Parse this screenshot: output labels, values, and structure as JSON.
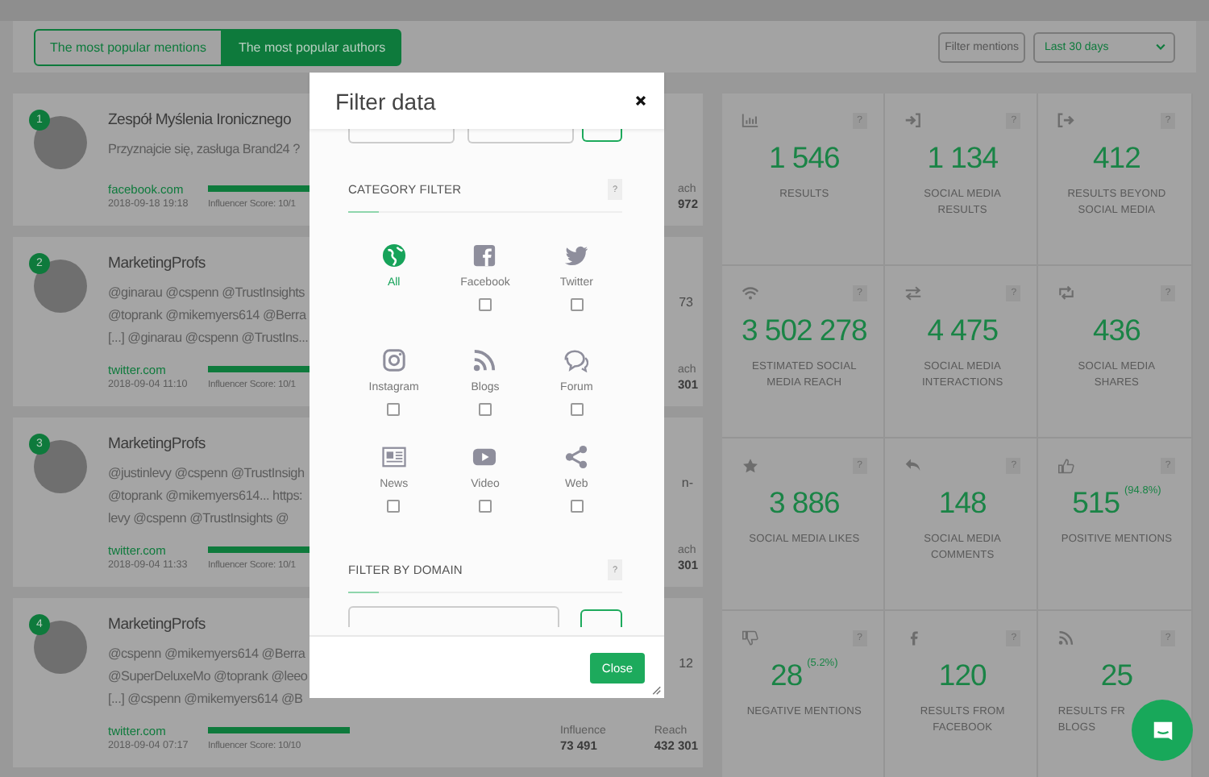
{
  "header": {
    "tabs": [
      {
        "label": "The most popular mentions",
        "selected": false
      },
      {
        "label": "The most popular authors",
        "selected": true
      }
    ],
    "filter_button": "Filter mentions",
    "period": "Last 30 days"
  },
  "authors": [
    {
      "rank": "1",
      "name": "Zespół Myślenia Ironicznego",
      "lines": [
        "Przyznajcie się, zasługa Brand24 ?"
      ],
      "source": "facebook.com",
      "date": "2018-09-18 19:18",
      "score": {
        "level": 1,
        "label": "Influencer Score: 10/1"
      },
      "metrics": [
        {
          "label": "ach",
          "value": "972"
        }
      ]
    },
    {
      "rank": "2",
      "name": "MarketingProfs",
      "lines": [
        "@ginarau @cspenn @TrustInsights",
        "@toprank @mikemyers614 @Berra",
        "[...] @ginarau @cspenn @TrustIns..."
      ],
      "source": "twitter.com",
      "date": "2018-09-04 11:10",
      "score": {
        "level": 1,
        "label": "Influencer Score: 10/1"
      },
      "edge_text": "73",
      "metrics": [
        {
          "label": "ach",
          "value": "301"
        }
      ]
    },
    {
      "rank": "3",
      "name": "MarketingProfs",
      "lines": [
        "@justinlevy @cspenn @TrustInsigh",
        "@toprank @mikemyers614... https:",
        "levy @cspenn @TrustInsights @"
      ],
      "source": "twitter.com",
      "date": "2018-09-04 11:33",
      "score": {
        "level": 1,
        "label": "Influencer Score: 10/1"
      },
      "edge_text": "n-",
      "metrics": [
        {
          "label": "ach",
          "value": "301"
        }
      ]
    },
    {
      "rank": "4",
      "name": "MarketingProfs",
      "lines": [
        "@cspenn @mikemyers614 @Berra",
        "@SuperDeluxeMo @toprank @leeo",
        "[...] @cspenn @mikemyers614 @B"
      ],
      "source": "twitter.com",
      "date": "2018-09-04 07:17",
      "score": {
        "level": 1,
        "label": "Influencer Score: 10/10"
      },
      "edge_text": "12",
      "metrics": [
        {
          "label": "Influence",
          "value": "73 491"
        },
        {
          "label": "Reach",
          "value": "432 301"
        }
      ]
    }
  ],
  "stats": [
    {
      "value": "1 546",
      "label": [
        "RESULTS"
      ],
      "help": "?"
    },
    {
      "value": "1 134",
      "label": [
        "SOCIAL MEDIA",
        "RESULTS"
      ],
      "help": "?"
    },
    {
      "value": "412",
      "label": [
        "RESULTS BEYOND",
        "SOCIAL MEDIA"
      ],
      "help": "?"
    },
    {
      "value": "3 502 278",
      "label": [
        "ESTIMATED SOCIAL",
        "MEDIA REACH"
      ],
      "help": "?"
    },
    {
      "value": "4 475",
      "label": [
        "SOCIAL MEDIA",
        "INTERACTIONS"
      ],
      "help": "?"
    },
    {
      "value": "436",
      "label": [
        "SOCIAL MEDIA",
        "SHARES"
      ],
      "help": "?"
    },
    {
      "value": "3 886",
      "label": [
        "SOCIAL MEDIA LIKES"
      ],
      "help": "?"
    },
    {
      "value": "148",
      "label": [
        "SOCIAL MEDIA",
        "COMMENTS"
      ],
      "help": "?"
    },
    {
      "value": "515",
      "percent": "(94.8%)",
      "label": [
        "POSITIVE MENTIONS"
      ],
      "help": "?"
    },
    {
      "value": "28",
      "percent": "(5.2%)",
      "label": [
        "NEGATIVE MENTIONS"
      ],
      "help": "?"
    },
    {
      "value": "120",
      "label": [
        "RESULTS FROM",
        "FACEBOOK"
      ],
      "help": "?"
    },
    {
      "value": "25",
      "label": [
        "RESULTS FR",
        "BLOGS"
      ],
      "help": "?"
    }
  ],
  "modal": {
    "title": "Filter data",
    "category_filter": {
      "title": "CATEGORY FILTER",
      "help": "?",
      "items": [
        {
          "kind": "all",
          "label": "All",
          "selected": true
        },
        {
          "kind": "source",
          "label": "Facebook",
          "selected": false,
          "checked": false
        },
        {
          "kind": "source",
          "label": "Twitter",
          "selected": false,
          "checked": false
        },
        {
          "kind": "source",
          "label": "Instagram",
          "selected": false,
          "checked": false
        },
        {
          "kind": "source",
          "label": "Blogs",
          "selected": false,
          "checked": false
        },
        {
          "kind": "source",
          "label": "Forum",
          "selected": false,
          "checked": false
        },
        {
          "kind": "source",
          "label": "News",
          "selected": false,
          "checked": false
        },
        {
          "kind": "source",
          "label": "Video",
          "selected": false,
          "checked": false
        },
        {
          "kind": "source",
          "label": "Web",
          "selected": false,
          "checked": false
        }
      ]
    },
    "domain_filter": {
      "title": "FILTER BY DOMAIN",
      "help": "?"
    },
    "close_button": "Close"
  }
}
